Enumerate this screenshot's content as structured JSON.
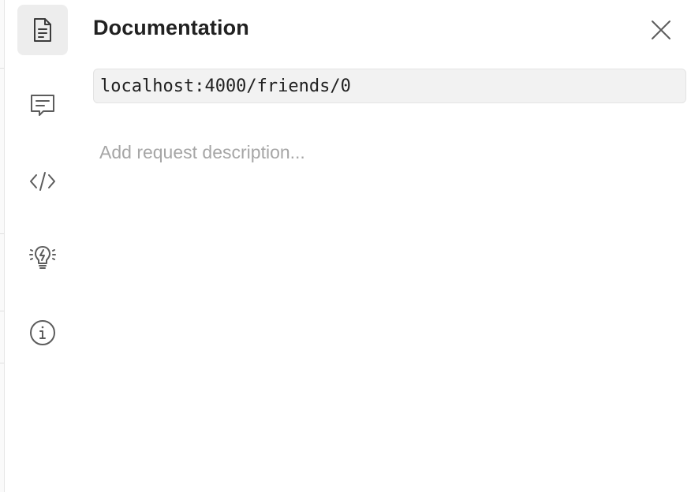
{
  "panel": {
    "title": "Documentation",
    "url": "localhost:4000/friends/0",
    "description_placeholder": "Add request description..."
  },
  "rail": {
    "items": [
      {
        "icon": "document-icon",
        "active": true
      },
      {
        "icon": "comment-icon",
        "active": false
      },
      {
        "icon": "code-icon",
        "active": false
      },
      {
        "icon": "lightbulb-icon",
        "active": false
      },
      {
        "icon": "info-icon",
        "active": false
      }
    ]
  },
  "colors": {
    "text": "#212121",
    "placeholder": "#a6a6a6",
    "icon": "#5c5c5c",
    "active_bg": "#ededed",
    "url_bg": "#f2f2f2"
  }
}
